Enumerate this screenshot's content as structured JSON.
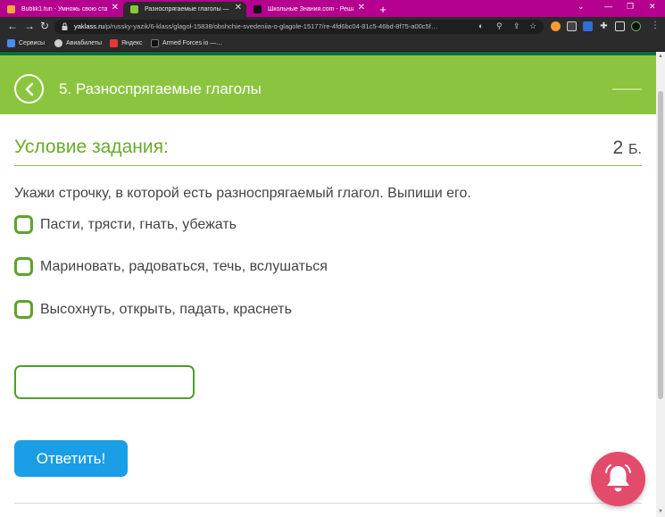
{
  "browser": {
    "tabs": [
      {
        "title": "Bublik1.fun - Умножь свою ста…",
        "active": false,
        "favicon_color": "#f3a83b"
      },
      {
        "title": "Разноспрягаемые глаголы — зад…",
        "active": true,
        "favicon_color": "#8bc53f"
      },
      {
        "title": "Школьные Знания.com - Решаем…",
        "active": false,
        "favicon_color": "#111111"
      }
    ],
    "new_tab": "+",
    "url_domain": "yaklass.ru",
    "url_path": "/p/russky-yazik/6-klass/glagol-15838/obshchie-svedeniia-o-glagole-15177/re-4fd6bc04-81c5-46bd-8f75-a00c5f…",
    "bookmarks": [
      {
        "label": "Сервисы",
        "color": "#4a8af4"
      },
      {
        "label": "Авиабилеты",
        "color": "#cfcfcf"
      },
      {
        "label": "Яндекс",
        "color": "#e53935"
      },
      {
        "label": "Armed Forces io —…",
        "color": "#111111"
      }
    ]
  },
  "header": {
    "title": "5. Разноспрягаемые глаголы",
    "bg_color": "#8bc53f"
  },
  "task": {
    "condition_label": "Условие задания:",
    "points_value": "2",
    "points_unit": "Б.",
    "question": "Укажи строчку, в которой есть разноспрягаемый глагол. Выпиши его.",
    "options": [
      {
        "label": "Пасти, трясти, гнать, убежать",
        "checked": false
      },
      {
        "label": "Мариновать, радоваться, течь, вслушаться",
        "checked": false
      },
      {
        "label": "Высохнуть, открыть, падать, краснеть",
        "checked": false
      }
    ],
    "answer_value": "",
    "submit_label": "Ответить!"
  },
  "colors": {
    "accent_green": "#8bc53f",
    "submit_blue": "#1a9ee6",
    "bell_pink": "#e24b6a"
  }
}
